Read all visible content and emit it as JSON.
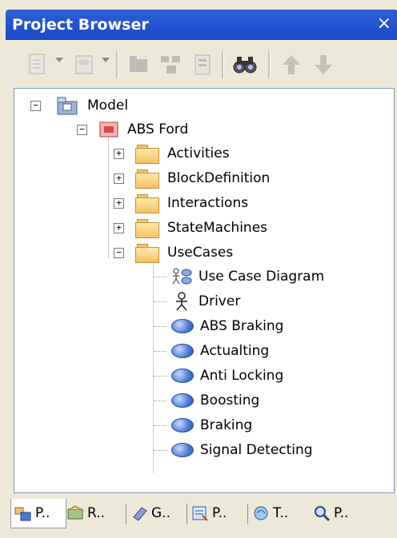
{
  "window": {
    "title": "Project Browser",
    "close_glyph": "×"
  },
  "toolbar": {
    "items": [
      "new-element-icon",
      "new-diagram-icon",
      "new-package-icon",
      "element-tree-icon",
      "properties-icon",
      "find-icon",
      "move-up-icon",
      "move-down-icon"
    ]
  },
  "tree": {
    "root": {
      "label": "Model",
      "expanded": true,
      "icon": "model-root-icon"
    },
    "package": {
      "label": "ABS Ford",
      "expanded": true,
      "icon": "package-icon"
    },
    "folders": [
      {
        "label": "Activities",
        "expanded": false
      },
      {
        "label": "BlockDefinition",
        "expanded": false
      },
      {
        "label": "Interactions",
        "expanded": false
      },
      {
        "label": "StateMachines",
        "expanded": false
      },
      {
        "label": "UseCases",
        "expanded": true
      }
    ],
    "usecase_children": [
      {
        "label": "Use Case Diagram",
        "icon": "use-case-diagram-icon"
      },
      {
        "label": "Driver",
        "icon": "actor-icon"
      },
      {
        "label": "ABS Braking",
        "icon": "use-case-icon"
      },
      {
        "label": "Actualting",
        "icon": "use-case-icon"
      },
      {
        "label": "Anti Locking",
        "icon": "use-case-icon"
      },
      {
        "label": "Boosting",
        "icon": "use-case-icon"
      },
      {
        "label": "Braking",
        "icon": "use-case-icon"
      },
      {
        "label": "Signal Detecting",
        "icon": "use-case-icon"
      }
    ]
  },
  "bottom_tabs": [
    {
      "label": "P..",
      "icon": "project-icon",
      "active": true
    },
    {
      "label": "R..",
      "icon": "resources-icon",
      "active": false
    },
    {
      "label": "G..",
      "icon": "glossary-icon",
      "active": false
    },
    {
      "label": "P..",
      "icon": "properties-icon",
      "active": false
    },
    {
      "label": "T..",
      "icon": "toolbox-icon",
      "active": false
    },
    {
      "label": "P..",
      "icon": "search-icon",
      "active": false
    }
  ]
}
